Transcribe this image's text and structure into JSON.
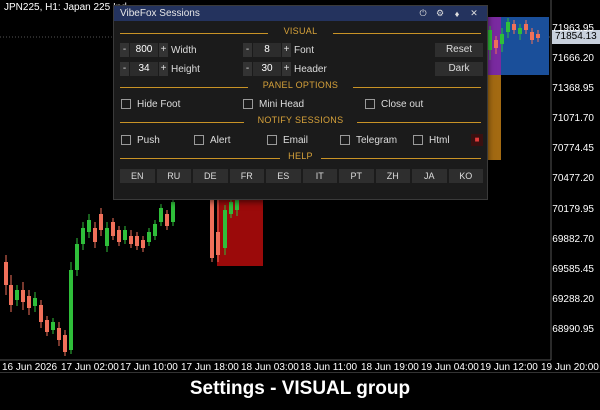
{
  "chart": {
    "symbol": "JPN225, H1:  Japan 225 Ind",
    "current_price": "71854.13",
    "price_labels": [
      "71963.95",
      "71666.20",
      "71368.95",
      "71071.70",
      "70774.45",
      "70477.20",
      "70179.95",
      "69882.70",
      "69585.45",
      "69288.20",
      "68990.95"
    ],
    "time_labels": [
      "16 Jun 2026",
      "17 Jun 02:00",
      "17 Jun 10:00",
      "17 Jun 18:00",
      "18 Jun 03:00",
      "18 Jun 11:00",
      "18 Jun 19:00",
      "19 Jun 04:00",
      "19 Jun 12:00",
      "19 Jun 20:00"
    ],
    "colors": {
      "bull": "#2fbf3a",
      "bear": "#f0705a",
      "session_red": "#9b0a0a",
      "session_blue": "#1a4f9a",
      "session_purple": "#7a2aa0",
      "session_orange": "#a36a12"
    }
  },
  "caption": "Settings - VISUAL group",
  "panel": {
    "title": "VibeFox Sessions",
    "icons": [
      "power-icon",
      "gear-icon",
      "pin-icon",
      "close-icon"
    ],
    "icon_glyphs": [
      "⏻",
      "⚙",
      "♦",
      "✕"
    ],
    "visual": {
      "header": "VISUAL",
      "width": {
        "label": "Width",
        "value": "800"
      },
      "height": {
        "label": "Height",
        "value": "34"
      },
      "font": {
        "label": "Font",
        "value": "8"
      },
      "header_size": {
        "label": "Header",
        "value": "30"
      },
      "minus": "-",
      "plus": "+",
      "reset_label": "Reset",
      "theme_label": "Dark"
    },
    "panel_options": {
      "header": "PANEL OPTIONS",
      "hide_foot": "Hide Foot",
      "mini_head": "Mini Head",
      "close_out": "Close out"
    },
    "notify": {
      "header": "NOTIFY SESSIONS",
      "push": "Push",
      "alert": "Alert",
      "email": "Email",
      "telegram": "Telegram",
      "html": "Html"
    },
    "help": {
      "header": "HELP",
      "languages": [
        "EN",
        "RU",
        "DE",
        "FR",
        "ES",
        "IT",
        "PT",
        "ZH",
        "JA",
        "KO"
      ]
    }
  }
}
